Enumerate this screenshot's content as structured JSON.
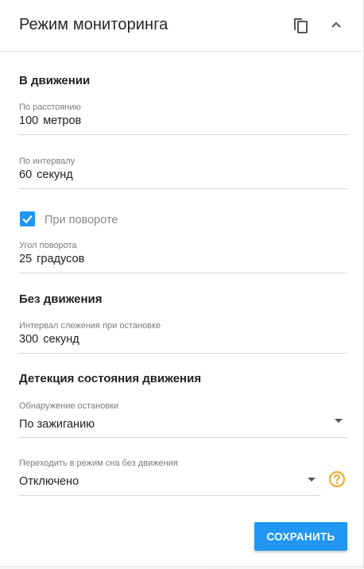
{
  "header": {
    "title": "Режим мониторинга",
    "copy_icon": "copy-icon",
    "collapse_icon": "chevron-up-icon"
  },
  "moving": {
    "section_title": "В движении",
    "distance": {
      "label": "По расстоянию",
      "value": "100",
      "unit": "метров"
    },
    "interval": {
      "label": "По интервалу",
      "value": "60",
      "unit": "секунд"
    },
    "turn": {
      "checkbox_label": "При повороте",
      "checked": true
    },
    "turn_angle": {
      "label": "Угол поворота",
      "value": "25",
      "unit": "градусов"
    }
  },
  "stationary": {
    "section_title": "Без движения",
    "stop_interval": {
      "label": "Интервал слежения при остановке",
      "value": "300",
      "unit": "секунд"
    }
  },
  "detection": {
    "section_title": "Детекция состояния движения",
    "stop_detection": {
      "label": "Обнаружение остановки",
      "value": "По зажиганию"
    },
    "sleep_mode": {
      "label": "Переходить в режим сна без движения",
      "value": "Отключено",
      "help_icon": "help-circle-icon"
    }
  },
  "actions": {
    "save_label": "СОХРАНИТЬ"
  },
  "colors": {
    "accent": "#2196f3",
    "help": "#f5a623",
    "text": "#212121",
    "label": "#7a7a7a"
  }
}
